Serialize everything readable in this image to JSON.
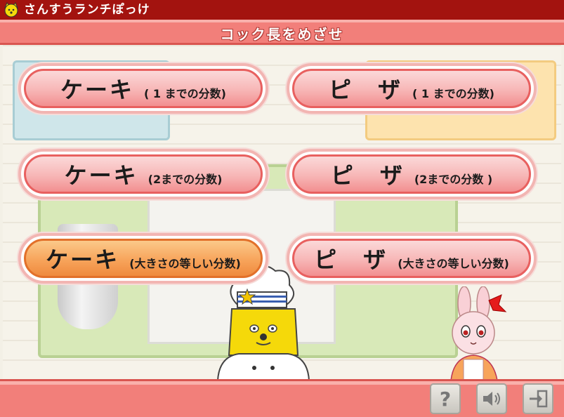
{
  "app": {
    "title": "さんすうランチぽっけ"
  },
  "header": {
    "title": "コック長をめざせ"
  },
  "buttons": [
    {
      "main": "ケーキ",
      "sub": "( 1 までの分数)"
    },
    {
      "main": "ピ　ザ",
      "sub": "( 1 までの分数)"
    },
    {
      "main": "ケーキ",
      "sub": "(2までの分数)"
    },
    {
      "main": "ピ　ザ",
      "sub": "(2までの分数 )"
    },
    {
      "main": "ケーキ",
      "sub": "(大きさの等しい分数)"
    },
    {
      "main": "ピ　ザ",
      "sub": "(大きさの等しい分数)"
    }
  ],
  "controls": {
    "help": "?"
  },
  "colors": {
    "titlebar": "#a3130f",
    "accent": "#f27f7a",
    "button_active": "#f7a45b"
  }
}
